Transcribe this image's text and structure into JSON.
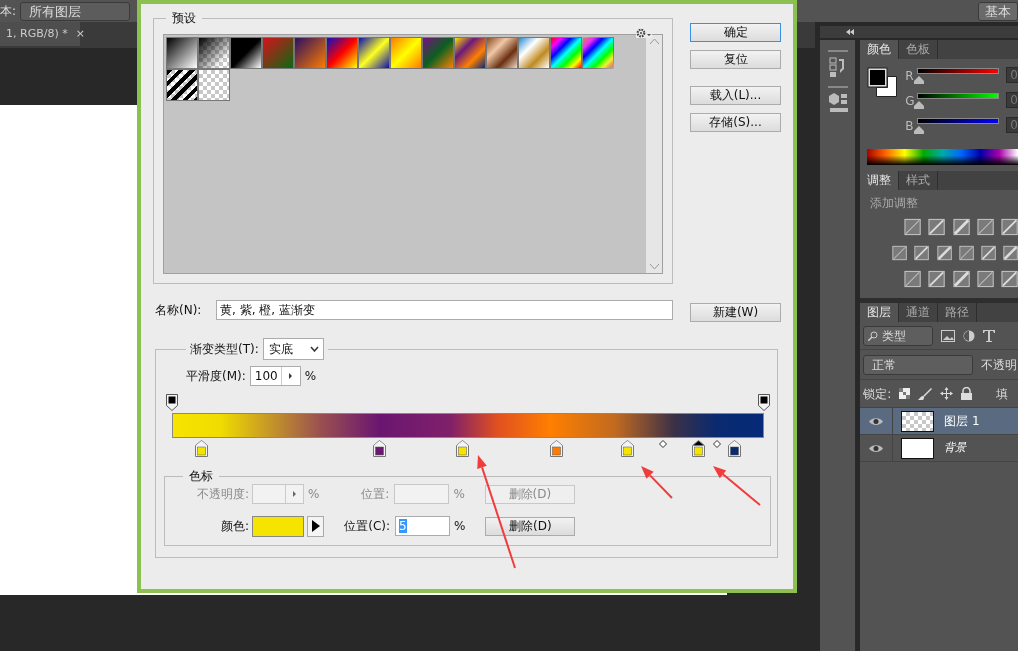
{
  "app": {
    "options_label": "本:",
    "layer_select": "所有图层",
    "workspace_button": "基本",
    "doc_tab": {
      "title": "1, RGB/8) *",
      "close": "×"
    }
  },
  "dialog": {
    "presets": {
      "title": "预设",
      "items": [
        {
          "kind": "gradient"
        },
        {
          "kind": "fade"
        },
        {
          "kind": "gradient"
        },
        {
          "kind": "gradient"
        },
        {
          "kind": "gradient"
        },
        {
          "kind": "gradient"
        },
        {
          "kind": "gradient"
        },
        {
          "kind": "gradient"
        },
        {
          "kind": "gradient"
        },
        {
          "kind": "gradient"
        },
        {
          "kind": "gradient"
        },
        {
          "kind": "gradient"
        },
        {
          "kind": "gradient"
        },
        {
          "kind": "fade-spectrum"
        },
        {
          "kind": "stripes"
        },
        {
          "kind": "transparent"
        }
      ]
    },
    "buttons": [
      {
        "label": "确定",
        "default": true
      },
      {
        "label": "复位",
        "default": false
      },
      {
        "label": "载入(L)...",
        "default": false
      },
      {
        "label": "存储(S)...",
        "default": false
      }
    ],
    "name_label": "名称(N):",
    "name_value": "黄, 紫, 橙, 蓝渐变",
    "new_button": "新建(W)",
    "type_label": "渐变类型(T):",
    "type_value": "实底",
    "smooth_label": "平滑度(M):",
    "smooth_value": "100",
    "smooth_unit": "%",
    "opacity_stops": [
      {
        "level": 0
      },
      {
        "level": 1
      }
    ],
    "color_stops": [
      {
        "level": 0.05,
        "color": "#f5e400",
        "selected": false
      },
      {
        "level": 0.35,
        "color": "#6a1a6e",
        "selected": false
      },
      {
        "level": 0.49,
        "color": "#f5e400",
        "selected": false
      },
      {
        "level": 0.65,
        "color": "#ff7a00",
        "selected": false
      },
      {
        "level": 0.77,
        "color": "#f5e400",
        "selected": false
      },
      {
        "level": 0.89,
        "color": "#f5e400",
        "selected": true
      },
      {
        "level": 0.95,
        "color": "#0a2a6e",
        "selected": false
      }
    ],
    "midpoints": [
      {
        "level": 0.83
      },
      {
        "level": 0.92
      }
    ],
    "stops_group": {
      "title": "色标",
      "opacity_label": "不透明度:",
      "opacity_unit": "%",
      "opacity_location_label": "位置:",
      "opacity_location_unit": "%",
      "opacity_delete": "删除(D)",
      "opacity_disabled": true,
      "color_label": "颜色:",
      "color": "#f5e400",
      "location_label": "位置(C):",
      "location_value": "5",
      "location_unit": "%",
      "delete": "删除(D)"
    }
  },
  "panels": {
    "color_tabs": [
      {
        "label": "颜色",
        "selected": true
      },
      {
        "label": "色板",
        "selected": false
      }
    ],
    "channels": [
      {
        "label": "R",
        "level": 0,
        "value": "0"
      },
      {
        "label": "G",
        "level": 0,
        "value": "0"
      },
      {
        "label": "B",
        "level": 0,
        "value": "0"
      }
    ],
    "adjust_tabs": [
      {
        "label": "调整",
        "selected": true
      },
      {
        "label": "样式",
        "selected": false
      }
    ],
    "adjust_title": "添加调整",
    "layer_tabs": [
      {
        "label": "图层",
        "selected": true
      },
      {
        "label": "通道",
        "selected": false
      },
      {
        "label": "路径",
        "selected": false
      }
    ],
    "filter_kind": "类型",
    "blend_mode": "正常",
    "opacity_label": "不透明",
    "lock_label": "锁定:",
    "fill_label": "填",
    "layers": [
      {
        "name": "图层 1",
        "kind": "transparent",
        "selected": true
      },
      {
        "name": "背景",
        "kind": "background",
        "selected": false
      }
    ]
  }
}
